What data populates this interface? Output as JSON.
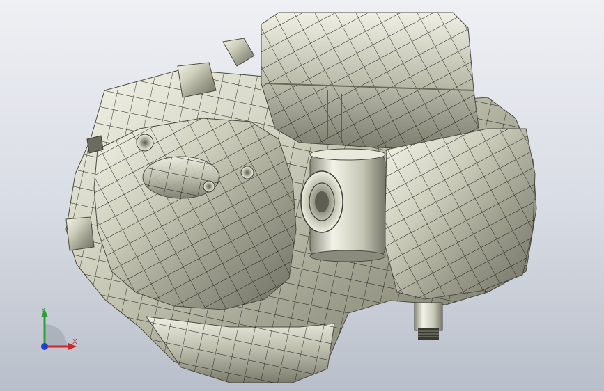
{
  "view": {
    "background_top": "#eef0f4",
    "background_bottom": "#b9bfca",
    "model_color": "#c9c9b6",
    "mesh_color": "#1c1c1c"
  },
  "triad": {
    "x_label": "X",
    "y_label": "Y",
    "x_color": "#d0262b",
    "y_color": "#2f9e3a",
    "z_color": "#1e3fd0"
  }
}
